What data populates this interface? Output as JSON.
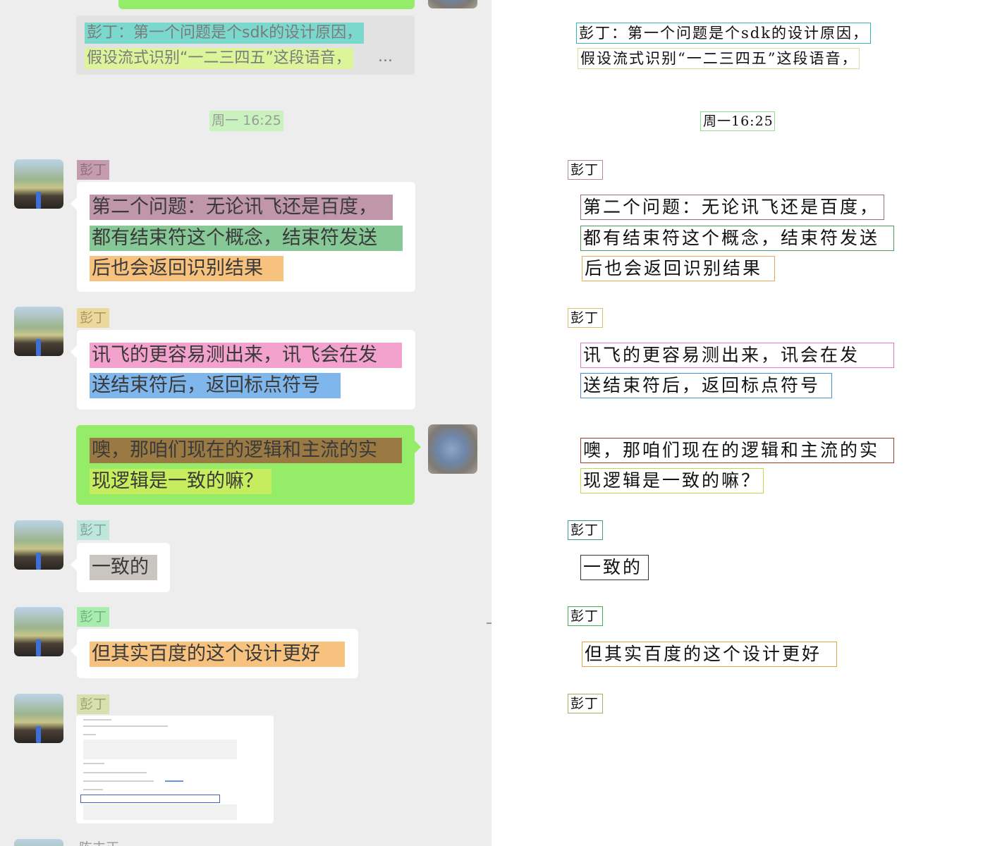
{
  "chat": {
    "quote": {
      "line1": "彭丁：第一个问题是个sdk的设计原因，",
      "line2": "假设流式识别“一二三四五”这段语音，",
      "ellipsis": "..."
    },
    "timestamp": "周一 16:25",
    "messages": [
      {
        "sender": "彭丁",
        "lines": [
          "第二个问题：无论讯飞还是百度，",
          "都有结束符这个概念，结束符发送",
          "后也会返回识别结果"
        ]
      },
      {
        "sender": "彭丁",
        "lines": [
          "讯飞的更容易测出来，讯飞会在发",
          "送结束符后，返回标点符号"
        ]
      },
      {
        "sender": "me",
        "lines": [
          "噢，那咱们现在的逻辑和主流的实",
          "现逻辑是一致的嘛？"
        ]
      },
      {
        "sender": "彭丁",
        "lines": [
          "一致的"
        ]
      },
      {
        "sender": "彭丁",
        "lines": [
          "但其实百度的这个设计更好"
        ]
      },
      {
        "sender": "彭丁",
        "type": "image-card"
      }
    ],
    "footer_sender": "陈丰正"
  },
  "ocr": {
    "quote_line1": "彭丁：第一个问题是个sdk的设计原因，",
    "quote_line2": "假设流式识别“一二三四五”这段语音，",
    "timestamp": "周一16:25",
    "sender_1": "彭丁",
    "msg1_line1": "第二个问题：无论讯飞还是百度，",
    "msg1_line2": "都有结束符这个概念，结束符发送",
    "msg1_line3": "后也会返回识别结果",
    "sender_2": "彭丁",
    "msg2_line1": "讯飞的更容易测出来，讯会在发",
    "msg2_line2": "送结束符后，返回标点符号",
    "msg3_line1": "噢，那咱们现在的逻辑和主流的实",
    "msg3_line2": "现逻辑是一致的嘛？",
    "sender_3": "彭丁",
    "msg4_line1": "一致的",
    "sender_4": "彭丁",
    "msg5_line1": "但其实百度的这个设计更好",
    "sender_5": "彭丁"
  },
  "colors": {
    "chat_background": "#ededed",
    "self_bubble": "#95ec69",
    "peer_bubble": "#ffffff",
    "highlight_teal": "#7ad8cd",
    "highlight_lime": "#ddf59a",
    "highlight_mauve": "#bf97a8",
    "highlight_green": "#86c896",
    "highlight_orange": "#f7c27e",
    "highlight_pink": "#f3a2ce",
    "highlight_blue": "#7fb6ec",
    "highlight_brown": "#9a7a42",
    "highlight_gray": "#c9c6c2"
  },
  "icons": [
    "avatar-peng-ding",
    "avatar-self",
    "chat-image-thumbnail"
  ]
}
